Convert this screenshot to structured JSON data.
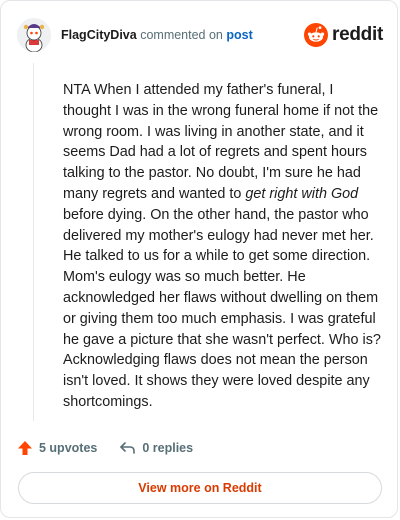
{
  "header": {
    "username": "FlagCityDiva",
    "action_text": "commented on",
    "post_link": "post",
    "brand_text": "reddit"
  },
  "comment": {
    "part1": "NTA When I attended my father's funeral, I thought I was in the wrong funeral home if not the wrong room. I was living in another state, and it seems Dad had a lot of regrets and spent hours talking to the pastor. No doubt, I'm sure he had many regrets and wanted to ",
    "emphasis": "get right with God",
    "part2": " before dying. On the other hand, the pastor who delivered my mother's eulogy had never met her. He talked to us for a while to get some direction. Mom's eulogy was so much better. He acknowledged her flaws without dwelling on them or giving them too much emphasis. I was grateful he gave a picture that she wasn't perfect. Who is? Acknowledging flaws does not mean the person isn't loved. It shows they were loved despite any shortcomings."
  },
  "actions": {
    "upvotes": "5 upvotes",
    "replies": "0 replies"
  },
  "footer": {
    "view_more": "View more on Reddit"
  },
  "colors": {
    "accent": "#d93a00",
    "upvote": "#ff4500",
    "link": "#0a66c2"
  },
  "icons": {
    "avatar": "snoo-avatar",
    "brand": "reddit-logo-icon",
    "upvote": "upvote-arrow-icon",
    "reply": "reply-arrow-icon"
  }
}
